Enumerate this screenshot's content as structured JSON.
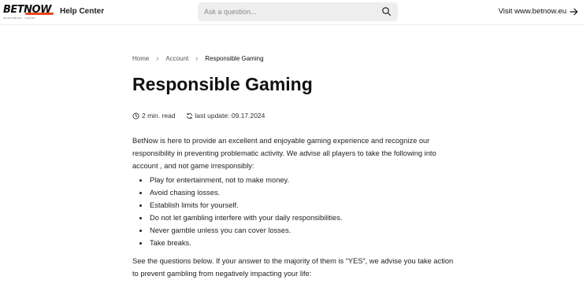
{
  "header": {
    "logo_text": "BETNOW",
    "logo_tagline": "SPORTSBOOK · CASINO",
    "help_center_label": "Help Center",
    "search_placeholder": "Ask a question...",
    "visit_label": "Visit www.betnow.eu",
    "brand_accent": "#e8481c"
  },
  "breadcrumb": {
    "home": "Home",
    "account": "Account",
    "current": "Responsible Gaming"
  },
  "article": {
    "title": "Responsible Gaming",
    "read_time": "2 min. read",
    "last_update": "last update: 09.17.2024",
    "intro": "BetNow is here to provide an excellent and enjoyable gaming experience and recognize our responsibility in preventing problematic activity. We advise all players to take the following into account , and not game irresponsibly:",
    "bullets": [
      "Play for entertainment, not to make money.",
      "Avoid chasing losses.",
      "Establish limits for yourself.",
      "Do not let gambling interfere with your daily responsibilities.",
      "Never gamble unless you can cover losses.",
      "Take breaks."
    ],
    "outro": "See the questions below. If your answer to the majority of them is “YES”, we advise you take action to prevent gambling from negatively impacting your life:"
  }
}
